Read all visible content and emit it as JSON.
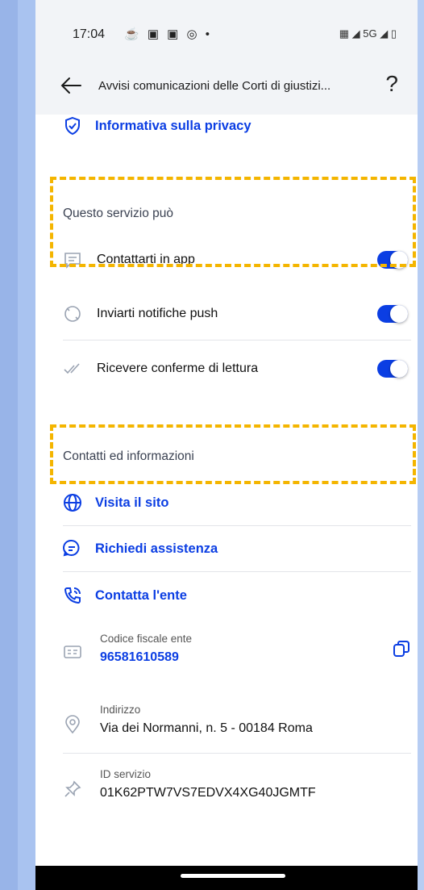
{
  "statusbar": {
    "time": "17:04",
    "notif_icons": "☕ ▣ ▣ ◎ •",
    "right": "▦ ◢ 5G ◢ ▯"
  },
  "appbar": {
    "title": "Avvisi comunicazioni delle Corti di giustizi...",
    "help": "?"
  },
  "privacy": {
    "label": "Informativa sulla privacy"
  },
  "service": {
    "title": "Questo servizio può",
    "items": [
      {
        "label": "Contattarti in app",
        "enabled": true
      },
      {
        "label": "Inviarti notifiche push",
        "enabled": true
      },
      {
        "label": "Ricevere conferme di lettura",
        "enabled": true
      }
    ]
  },
  "contacts": {
    "title": "Contatti ed informazioni",
    "links": [
      {
        "label": "Visita il sito"
      },
      {
        "label": "Richiedi assistenza"
      },
      {
        "label": "Contatta l'ente"
      }
    ],
    "fiscal": {
      "label": "Codice fiscale ente",
      "value": "96581610589"
    },
    "address": {
      "label": "Indirizzo",
      "value": "Via dei Normanni, n. 5 - 00184 Roma"
    },
    "service_id": {
      "label": "ID servizio",
      "value": "01K62PTW7VS7EDVX4XG40JGMTF"
    }
  },
  "colors": {
    "accent": "#0b3ee3",
    "highlight": "#f4b500"
  }
}
